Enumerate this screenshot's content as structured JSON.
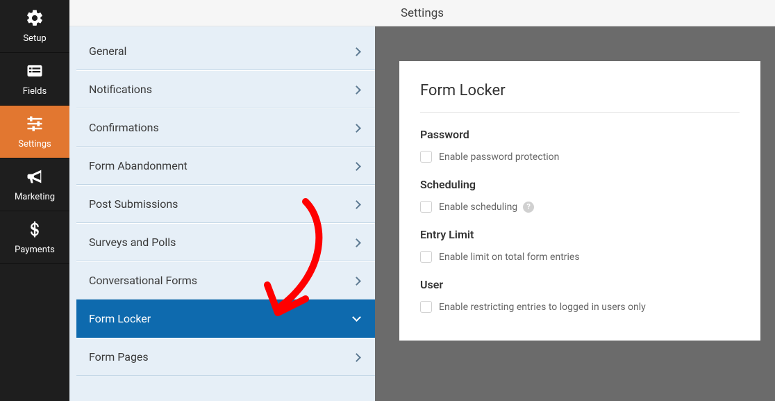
{
  "header": {
    "title": "Settings"
  },
  "nav": {
    "items": [
      {
        "label": "Setup"
      },
      {
        "label": "Fields"
      },
      {
        "label": "Settings"
      },
      {
        "label": "Marketing"
      },
      {
        "label": "Payments"
      }
    ]
  },
  "settings_list": {
    "items": [
      {
        "label": "General"
      },
      {
        "label": "Notifications"
      },
      {
        "label": "Confirmations"
      },
      {
        "label": "Form Abandonment"
      },
      {
        "label": "Post Submissions"
      },
      {
        "label": "Surveys and Polls"
      },
      {
        "label": "Conversational Forms"
      },
      {
        "label": "Form Locker"
      },
      {
        "label": "Form Pages"
      }
    ]
  },
  "panel": {
    "title": "Form Locker",
    "groups": {
      "password": {
        "heading": "Password",
        "option": "Enable password protection"
      },
      "scheduling": {
        "heading": "Scheduling",
        "option": "Enable scheduling"
      },
      "entry_limit": {
        "heading": "Entry Limit",
        "option": "Enable limit on total form entries"
      },
      "user": {
        "heading": "User",
        "option": "Enable restricting entries to logged in users only"
      }
    }
  }
}
